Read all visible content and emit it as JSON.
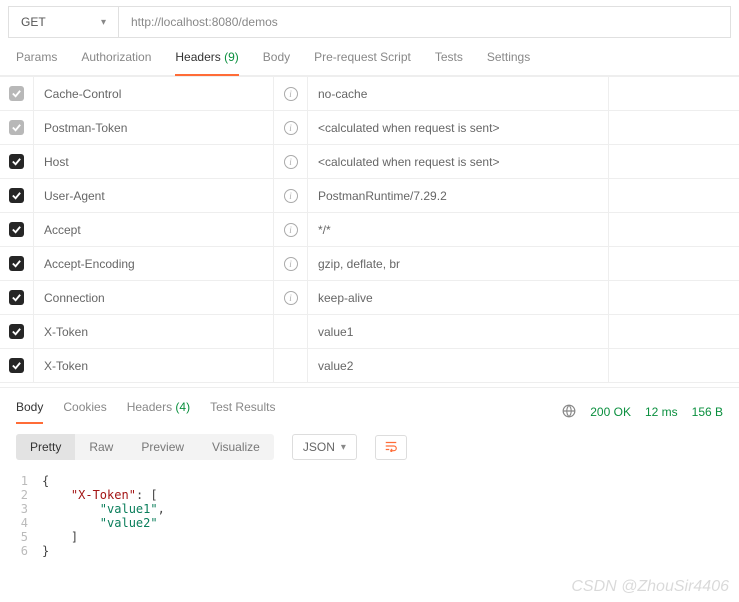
{
  "request": {
    "method": "GET",
    "url": "http://localhost:8080/demos"
  },
  "tabs": {
    "params": "Params",
    "authorization": "Authorization",
    "headers_label": "Headers",
    "headers_count": "(9)",
    "body": "Body",
    "prerequest": "Pre-request Script",
    "tests": "Tests",
    "settings": "Settings"
  },
  "headers": [
    {
      "checked": false,
      "key": "Cache-Control",
      "info": true,
      "value": "no-cache"
    },
    {
      "checked": false,
      "key": "Postman-Token",
      "info": true,
      "value": "<calculated when request is sent>"
    },
    {
      "checked": true,
      "key": "Host",
      "info": true,
      "value": "<calculated when request is sent>"
    },
    {
      "checked": true,
      "key": "User-Agent",
      "info": true,
      "value": "PostmanRuntime/7.29.2"
    },
    {
      "checked": true,
      "key": "Accept",
      "info": true,
      "value": "*/*"
    },
    {
      "checked": true,
      "key": "Accept-Encoding",
      "info": true,
      "value": "gzip, deflate, br"
    },
    {
      "checked": true,
      "key": "Connection",
      "info": true,
      "value": "keep-alive"
    },
    {
      "checked": true,
      "key": "X-Token",
      "info": false,
      "value": "value1"
    },
    {
      "checked": true,
      "key": "X-Token",
      "info": false,
      "value": "value2"
    }
  ],
  "response_tabs": {
    "body": "Body",
    "cookies": "Cookies",
    "headers_label": "Headers",
    "headers_count": "(4)",
    "test_results": "Test Results"
  },
  "response_meta": {
    "status": "200 OK",
    "time": "12 ms",
    "size": "156 B"
  },
  "view_modes": {
    "pretty": "Pretty",
    "raw": "Raw",
    "preview": "Preview",
    "visualize": "Visualize",
    "format": "JSON"
  },
  "body_json": {
    "l1": "{",
    "l2_indent": "    ",
    "l2_key": "\"X-Token\"",
    "l2_rest": ": [",
    "l3_indent": "        ",
    "l3_str": "\"value1\"",
    "l3_comma": ",",
    "l4_indent": "        ",
    "l4_str": "\"value2\"",
    "l5_indent": "    ",
    "l5": "]",
    "l6": "}"
  },
  "watermark": "CSDN @ZhouSir4406"
}
